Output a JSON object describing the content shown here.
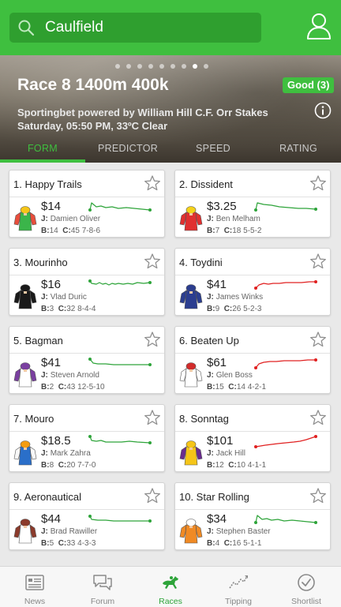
{
  "search": {
    "value": "Caulfield"
  },
  "carousel": {
    "count": 9,
    "active": 7
  },
  "race": {
    "title": "Race 8 1400m 400k",
    "going": "Good (3)",
    "sponsor": "Sportingbet powered by William Hill C.F. Orr Stakes",
    "details": "Saturday, 05:50 PM, 33ºC Clear"
  },
  "tabs": [
    {
      "label": "FORM",
      "active": true
    },
    {
      "label": "PREDICTOR",
      "active": false
    },
    {
      "label": "SPEED",
      "active": false
    },
    {
      "label": "RATING",
      "active": false
    }
  ],
  "runners": [
    {
      "name": "1. Happy Trails",
      "price": "$14",
      "jockey": "Damien Oliver",
      "barrier": "14",
      "career": "45 7-8-6",
      "trend": "green",
      "jersey": "#3bb54a",
      "sleeves": "#e94e3c",
      "cap": "#f5c518"
    },
    {
      "name": "2. Dissident",
      "price": "$3.25",
      "jockey": "Ben Melham",
      "barrier": "7",
      "career": "18 5-5-2",
      "trend": "green",
      "jersey": "#e03030",
      "sleeves": "#e03030",
      "cap": "#f5d21a"
    },
    {
      "name": "3. Mourinho",
      "price": "$16",
      "jockey": "Vlad Duric",
      "barrier": "3",
      "career": "32 8-4-4",
      "trend": "green",
      "jersey": "#1a1a1a",
      "sleeves": "#1a1a1a",
      "cap": "#1a1a1a"
    },
    {
      "name": "4. Toydini",
      "price": "$41",
      "jockey": "James Winks",
      "barrier": "9",
      "career": "26 5-2-3",
      "trend": "red",
      "jersey": "#2c3e8f",
      "sleeves": "#2c3e8f",
      "cap": "#2c3e8f"
    },
    {
      "name": "5. Bagman",
      "price": "$41",
      "jockey": "Steven Arnold",
      "barrier": "2",
      "career": "43 12-5-10",
      "trend": "green",
      "jersey": "#ffffff",
      "sleeves": "#7a3fa0",
      "cap": "#7a3fa0"
    },
    {
      "name": "6. Beaten Up",
      "price": "$61",
      "jockey": "Glen Boss",
      "barrier": "15",
      "career": "14 4-2-1",
      "trend": "red",
      "jersey": "#ffffff",
      "sleeves": "#ffffff",
      "cap": "#d22b2b"
    },
    {
      "name": "7. Mouro",
      "price": "$18.5",
      "jockey": "Mark Zahra",
      "barrier": "8",
      "career": "20 7-7-0",
      "trend": "green",
      "jersey": "#2a6fc9",
      "sleeves": "#f7f7f7",
      "cap": "#f39c12"
    },
    {
      "name": "8. Sonntag",
      "price": "$101",
      "jockey": "Jack Hill",
      "barrier": "12",
      "career": "10 4-1-1",
      "trend": "red",
      "jersey": "#f5c518",
      "sleeves": "#6a2c8f",
      "cap": "#f5c518"
    },
    {
      "name": "9. Aeronautical",
      "price": "$44",
      "jockey": "Brad Rawiller",
      "barrier": "5",
      "career": "33 4-3-3",
      "trend": "green",
      "jersey": "#ffffff",
      "sleeves": "#8b3a2b",
      "cap": "#8b3a2b"
    },
    {
      "name": "10. Star Rolling",
      "price": "$34",
      "jockey": "Stephen Baster",
      "barrier": "4",
      "career": "16 5-1-1",
      "trend": "green",
      "jersey": "#f08a24",
      "sleeves": "#f08a24",
      "cap": "#ffffff"
    }
  ],
  "labels": {
    "jockey": "J:",
    "barrier": "B:",
    "career": "C:"
  },
  "nav": [
    {
      "label": "News",
      "icon": "news-icon",
      "active": false
    },
    {
      "label": "Forum",
      "icon": "forum-icon",
      "active": false
    },
    {
      "label": "Races",
      "icon": "races-icon",
      "active": true
    },
    {
      "label": "Tipping",
      "icon": "tipping-icon",
      "active": false
    },
    {
      "label": "Shortlist",
      "icon": "shortlist-icon",
      "active": false
    }
  ],
  "colors": {
    "brand": "#3fbf3f",
    "trend_green": "#2ea43a",
    "trend_red": "#e02020"
  }
}
